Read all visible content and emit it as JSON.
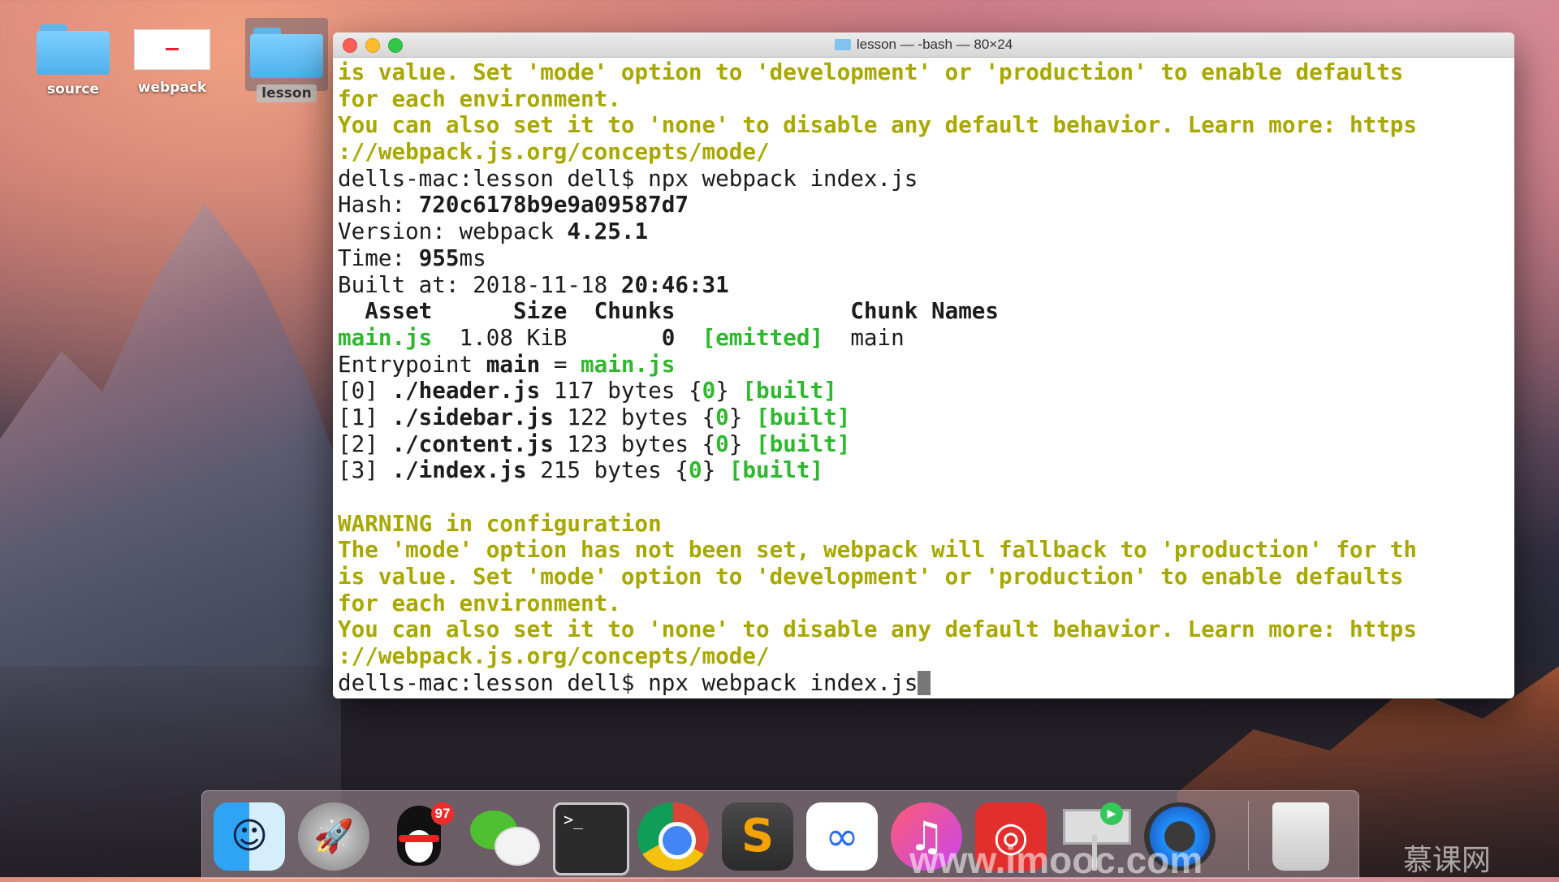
{
  "desktop": {
    "icons": [
      {
        "label": "source",
        "type": "folder"
      },
      {
        "label": "webpack",
        "type": "document"
      },
      {
        "label": "lesson",
        "type": "folder",
        "selected": true
      }
    ]
  },
  "terminal": {
    "title": "lesson — -bash — 80×24",
    "lines": [
      [
        {
          "t": "is value. Set 'mode' option to 'development' or 'production' to enable defaults",
          "s": "y"
        }
      ],
      [
        {
          "t": "for each environment.",
          "s": "y"
        }
      ],
      [
        {
          "t": "You can also set it to 'none' to disable any default behavior. Learn more: https",
          "s": "y"
        }
      ],
      [
        {
          "t": "://webpack.js.org/concepts/mode/",
          "s": "y"
        }
      ],
      [
        {
          "t": "dells-mac:lesson dell$ npx webpack index.js",
          "s": ""
        }
      ],
      [
        {
          "t": "Hash: ",
          "s": ""
        },
        {
          "t": "720c6178b9e9a09587d7",
          "s": "b"
        }
      ],
      [
        {
          "t": "Version: webpack ",
          "s": ""
        },
        {
          "t": "4.25.1",
          "s": "b"
        }
      ],
      [
        {
          "t": "Time: ",
          "s": ""
        },
        {
          "t": "955",
          "s": "b"
        },
        {
          "t": "ms",
          "s": ""
        }
      ],
      [
        {
          "t": "Built at: 2018-11-18 ",
          "s": ""
        },
        {
          "t": "20:46:31",
          "s": "b"
        }
      ],
      [
        {
          "t": "  Asset      Size  Chunks             Chunk Names",
          "s": "b"
        }
      ],
      [
        {
          "t": "main.js",
          "s": "gb"
        },
        {
          "t": "  1.08 KiB       ",
          "s": ""
        },
        {
          "t": "0",
          "s": "b"
        },
        {
          "t": "  ",
          "s": ""
        },
        {
          "t": "[emitted]",
          "s": "gb"
        },
        {
          "t": "  main",
          "s": ""
        }
      ],
      [
        {
          "t": "Entrypoint ",
          "s": ""
        },
        {
          "t": "main",
          "s": "b"
        },
        {
          "t": " = ",
          "s": ""
        },
        {
          "t": "main.js",
          "s": "gb"
        }
      ],
      [
        {
          "t": "[0] ",
          "s": ""
        },
        {
          "t": "./header.js",
          "s": "b"
        },
        {
          "t": " 117 bytes {",
          "s": ""
        },
        {
          "t": "0",
          "s": "gb"
        },
        {
          "t": "} ",
          "s": ""
        },
        {
          "t": "[built]",
          "s": "gb"
        }
      ],
      [
        {
          "t": "[1] ",
          "s": ""
        },
        {
          "t": "./sidebar.js",
          "s": "b"
        },
        {
          "t": " 122 bytes {",
          "s": ""
        },
        {
          "t": "0",
          "s": "gb"
        },
        {
          "t": "} ",
          "s": ""
        },
        {
          "t": "[built]",
          "s": "gb"
        }
      ],
      [
        {
          "t": "[2] ",
          "s": ""
        },
        {
          "t": "./content.js",
          "s": "b"
        },
        {
          "t": " 123 bytes {",
          "s": ""
        },
        {
          "t": "0",
          "s": "gb"
        },
        {
          "t": "} ",
          "s": ""
        },
        {
          "t": "[built]",
          "s": "gb"
        }
      ],
      [
        {
          "t": "[3] ",
          "s": ""
        },
        {
          "t": "./index.js",
          "s": "b"
        },
        {
          "t": " 215 bytes {",
          "s": ""
        },
        {
          "t": "0",
          "s": "gb"
        },
        {
          "t": "} ",
          "s": ""
        },
        {
          "t": "[built]",
          "s": "gb"
        }
      ],
      [
        {
          "t": "",
          "s": ""
        }
      ],
      [
        {
          "t": "WARNING in configuration",
          "s": "y"
        }
      ],
      [
        {
          "t": "The 'mode' option has not been set, webpack will fallback to 'production' for th",
          "s": "y"
        }
      ],
      [
        {
          "t": "is value. Set 'mode' option to 'development' or 'production' to enable defaults",
          "s": "y"
        }
      ],
      [
        {
          "t": "for each environment.",
          "s": "y"
        }
      ],
      [
        {
          "t": "You can also set it to 'none' to disable any default behavior. Learn more: https",
          "s": "y"
        }
      ],
      [
        {
          "t": "://webpack.js.org/concepts/mode/",
          "s": "y"
        }
      ]
    ],
    "prompt_line": "dells-mac:lesson dell$ npx webpack index.js"
  },
  "dock": {
    "items": [
      {
        "name": "finder-icon",
        "label": "Finder",
        "glyph": "☺"
      },
      {
        "name": "launchpad-icon",
        "label": "Launchpad",
        "glyph": "🚀"
      },
      {
        "name": "qq-icon",
        "label": "QQ",
        "badge": "97"
      },
      {
        "name": "wechat-icon",
        "label": "WeChat"
      },
      {
        "name": "terminal-icon",
        "label": "Terminal",
        "glyph": ">_"
      },
      {
        "name": "chrome-icon",
        "label": "Chrome"
      },
      {
        "name": "sublime-icon",
        "label": "Sublime Text",
        "glyph": "S"
      },
      {
        "name": "baidu-netdisk-icon",
        "label": "Baidu Netdisk",
        "glyph": "∞"
      },
      {
        "name": "itunes-icon",
        "label": "iTunes",
        "glyph": "♫"
      },
      {
        "name": "netease-music-icon",
        "label": "NetEase Music",
        "glyph": "◎"
      },
      {
        "name": "keynote-icon",
        "label": "Keynote",
        "glyph": "▶"
      },
      {
        "name": "quicktime-icon",
        "label": "QuickTime"
      },
      {
        "name": "trash-icon",
        "label": "Trash"
      }
    ]
  },
  "watermark": {
    "url": "www.imooc.com",
    "brand": "慕课网"
  },
  "colors": {
    "warning_yellow": "#a8a800",
    "success_green": "#2db82d"
  }
}
